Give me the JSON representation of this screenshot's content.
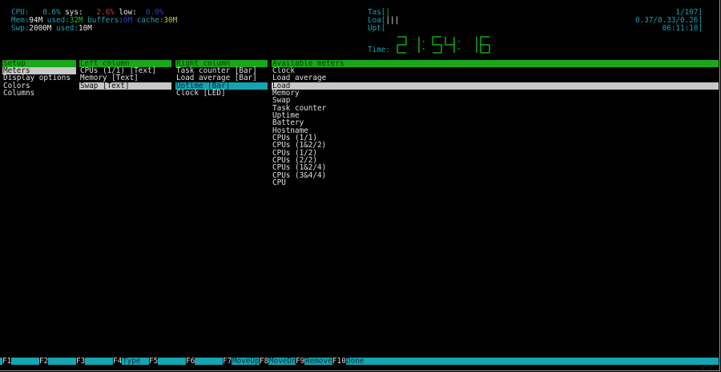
{
  "meters": {
    "cpu": {
      "label": "CPU:",
      "user": "0.6%",
      "sys_label": "sys:",
      "sys": "2.6%",
      "low_label": "low:",
      "low": "0.0%"
    },
    "mem": {
      "label": "Mem:",
      "total": "94M",
      "used_label": "used:",
      "used": "32M",
      "buffers_label": "buffers:",
      "buffers": "0M",
      "cache_label": "cache:",
      "cache": "30M"
    },
    "swp": {
      "label": "Swp:",
      "total": "2000M",
      "used_label": "used:",
      "used": "10M"
    },
    "tasks": {
      "label": "Tas[",
      "bar": "|",
      "value": "1/107]"
    },
    "load": {
      "label": "Loa[",
      "bar": "|||",
      "value": "0.37/0.33/0.26]"
    },
    "uptime": {
      "label": "Upt[",
      "value": "06:11:10]"
    },
    "clock": {
      "label": "Time:",
      "digits": [
        "2",
        "1",
        "5",
        "4",
        "1",
        "6"
      ]
    }
  },
  "setup": {
    "header": "Setup",
    "items": [
      "Meters",
      "Display options",
      "Colors",
      "Columns"
    ]
  },
  "left_column": {
    "header": "Left column",
    "items": [
      "CPUs (1/1) [Text]",
      "Memory [Text]",
      "Swap [Text]"
    ]
  },
  "right_column": {
    "header": "Right column",
    "items": [
      "Task counter [Bar]",
      "Load average [Bar]",
      "Uptime [Bar]",
      "Clock [LED]"
    ]
  },
  "available_meters": {
    "header": "Available meters",
    "items": [
      "Clock",
      "Load average",
      "Load",
      "Memory",
      "Swap",
      "Task counter",
      "Uptime",
      "Battery",
      "Hostname",
      "CPUs (1/1)",
      "CPUs (1&2/2)",
      "CPUs (1/2)",
      "CPUs (2/2)",
      "CPUs (1&2/4)",
      "CPUs (3&4/4)",
      "CPU"
    ]
  },
  "function_bar": [
    {
      "key": "F1",
      "label": ""
    },
    {
      "key": "F2",
      "label": ""
    },
    {
      "key": "F3",
      "label": ""
    },
    {
      "key": "F4",
      "label": "Type"
    },
    {
      "key": "F5",
      "label": ""
    },
    {
      "key": "F6",
      "label": ""
    },
    {
      "key": "F7",
      "label": "MoveUp"
    },
    {
      "key": "F8",
      "label": "MoveDn"
    },
    {
      "key": "F9",
      "label": "Remove"
    },
    {
      "key": "F10",
      "label": "Done"
    }
  ],
  "colors": {
    "accent": "#13a6b2",
    "header_green": "#18a818",
    "led_green": "#18c418"
  }
}
